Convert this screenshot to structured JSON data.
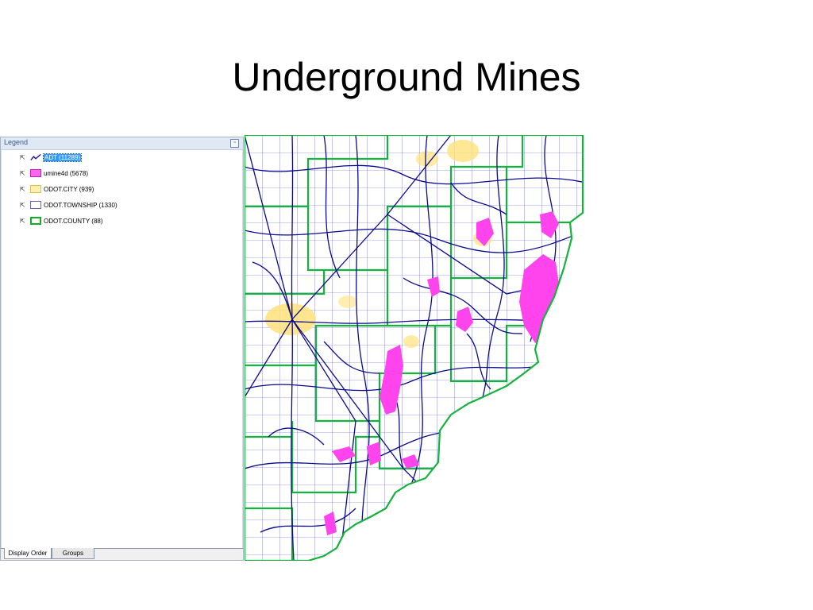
{
  "slide": {
    "title": "Underground Mines"
  },
  "legend": {
    "title": "Legend",
    "pin_glyph": "▫",
    "layers": [
      {
        "label": "ADT (11289)",
        "swatch": "line-icon",
        "selected": true
      },
      {
        "label": "umine4d (5678)",
        "swatch": "fill",
        "fill": "#ff66ee",
        "stroke": "#c020b8"
      },
      {
        "label": "ODOT.CITY (939)",
        "swatch": "fill",
        "fill": "#fff2a8",
        "stroke": "#d8c060"
      },
      {
        "label": "ODOT.TOWNSHIP (1330)",
        "swatch": "fill",
        "fill": "#ffffff",
        "stroke": "#6060c0"
      },
      {
        "label": "ODOT.COUNTY (88)",
        "swatch": "fill",
        "fill": "#ffffff",
        "stroke": "#10b020"
      }
    ],
    "tabs": [
      {
        "label": "Display Order",
        "active": true
      },
      {
        "label": "Groups",
        "active": false
      }
    ]
  },
  "map": {
    "colors": {
      "roads": "#0a0a8c",
      "township": "#4848c8",
      "county": "#14b43c",
      "mines": "#ff44ee",
      "city": "#ffe27a"
    }
  }
}
